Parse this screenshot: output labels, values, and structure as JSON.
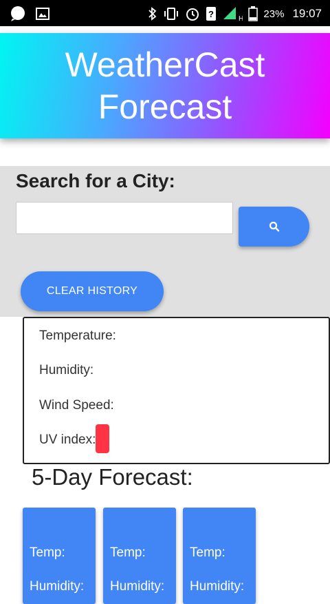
{
  "status_bar": {
    "battery_percent": "23%",
    "time": "19:07",
    "network_label": "H+"
  },
  "header": {
    "title": "WeatherCast Forecast"
  },
  "search": {
    "heading": "Search for a City:",
    "input_value": "",
    "input_placeholder": "",
    "search_icon": "search-icon"
  },
  "clear_history": {
    "label": "CLEAR HISTORY"
  },
  "current_weather": {
    "temperature_label": "Temperature:",
    "humidity_label": "Humidity:",
    "wind_label": "Wind Speed:",
    "uv_label": "UV index:",
    "uv_color": "#ff3344"
  },
  "forecast": {
    "heading": "5-Day Forecast:",
    "cards": [
      {
        "temp_label": "Temp:",
        "humidity_label": "Humidity:"
      },
      {
        "temp_label": "Temp:",
        "humidity_label": "Humidity:"
      },
      {
        "temp_label": "Temp:",
        "humidity_label": "Humidity:"
      }
    ]
  },
  "colors": {
    "accent": "#4285f4",
    "header_gradient_start": "#00f5f2",
    "header_gradient_end": "#f400ff",
    "panel_bg": "#e0e0e0"
  }
}
